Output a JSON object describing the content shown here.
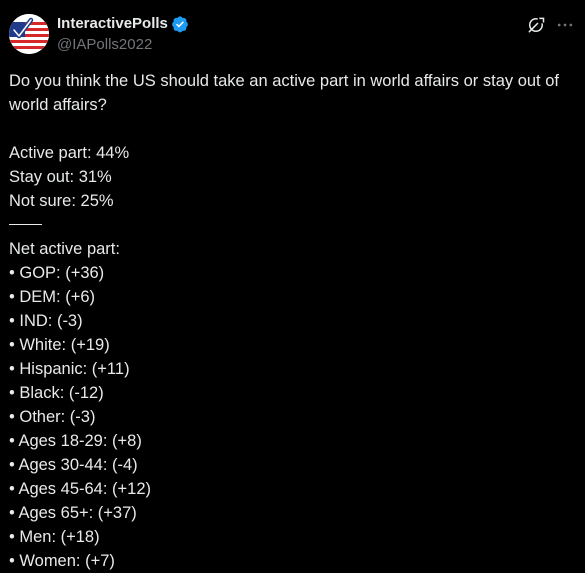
{
  "author": {
    "display_name": "InteractivePolls",
    "handle": "@IAPolls2022"
  },
  "icons": {
    "avatar": "flag-checkmark-logo",
    "verified": "verified-badge-icon",
    "grok": "grok-icon",
    "more": "more-icon"
  },
  "colors": {
    "background": "#000000",
    "text": "#e7e9ea",
    "muted": "#71767b",
    "verified": "#1d9bf0"
  },
  "tweet": {
    "question": "Do you think the US should take an active part in world affairs or stay out of world affairs?",
    "results": [
      "Active part: 44%",
      "Stay out: 31%",
      "Not sure: 25%"
    ],
    "divider": "——",
    "net_heading": "Net active part:",
    "net_items": [
      "• GOP: (+36)",
      "• DEM: (+6)",
      "• IND: (-3)",
      "• White: (+19)",
      "• Hispanic: (+11)",
      "• Black: (-12)",
      "• Other: (-3)",
      "• Ages 18-29: (+8)",
      "• Ages 30-44: (-4)",
      "• Ages 45-64: (+12)",
      "• Ages 65+: (+37)",
      "• Men: (+18)",
      "• Women: (+7)"
    ]
  }
}
